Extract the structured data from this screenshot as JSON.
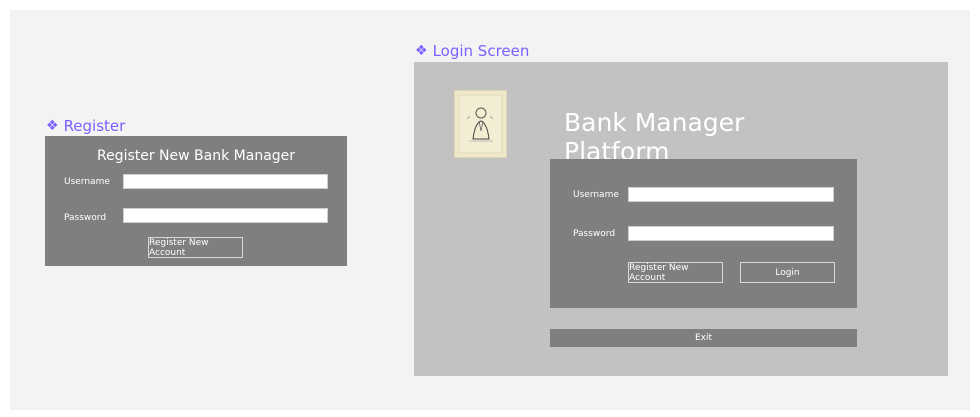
{
  "register_frame": {
    "frame_label": "Register",
    "frame_icon": "component-diamond-icon",
    "heading": "Register New Bank Manager",
    "username_label": "Username",
    "username_value": "",
    "password_label": "Password",
    "password_value": "",
    "register_button": "Register New Account"
  },
  "login_frame": {
    "frame_label": "Login Screen",
    "frame_icon": "component-diamond-icon",
    "app_title": "Bank Manager Platform",
    "username_label": "Username",
    "username_value": "",
    "password_label": "Password",
    "password_value": "",
    "register_button": "Register New Account",
    "login_button": "Login",
    "exit_button": "Exit"
  },
  "colors": {
    "accent": "#7b61ff",
    "panel_dark": "#7f7f7f",
    "panel_light": "#c2c2c2",
    "canvas": "#f3f3f3"
  }
}
